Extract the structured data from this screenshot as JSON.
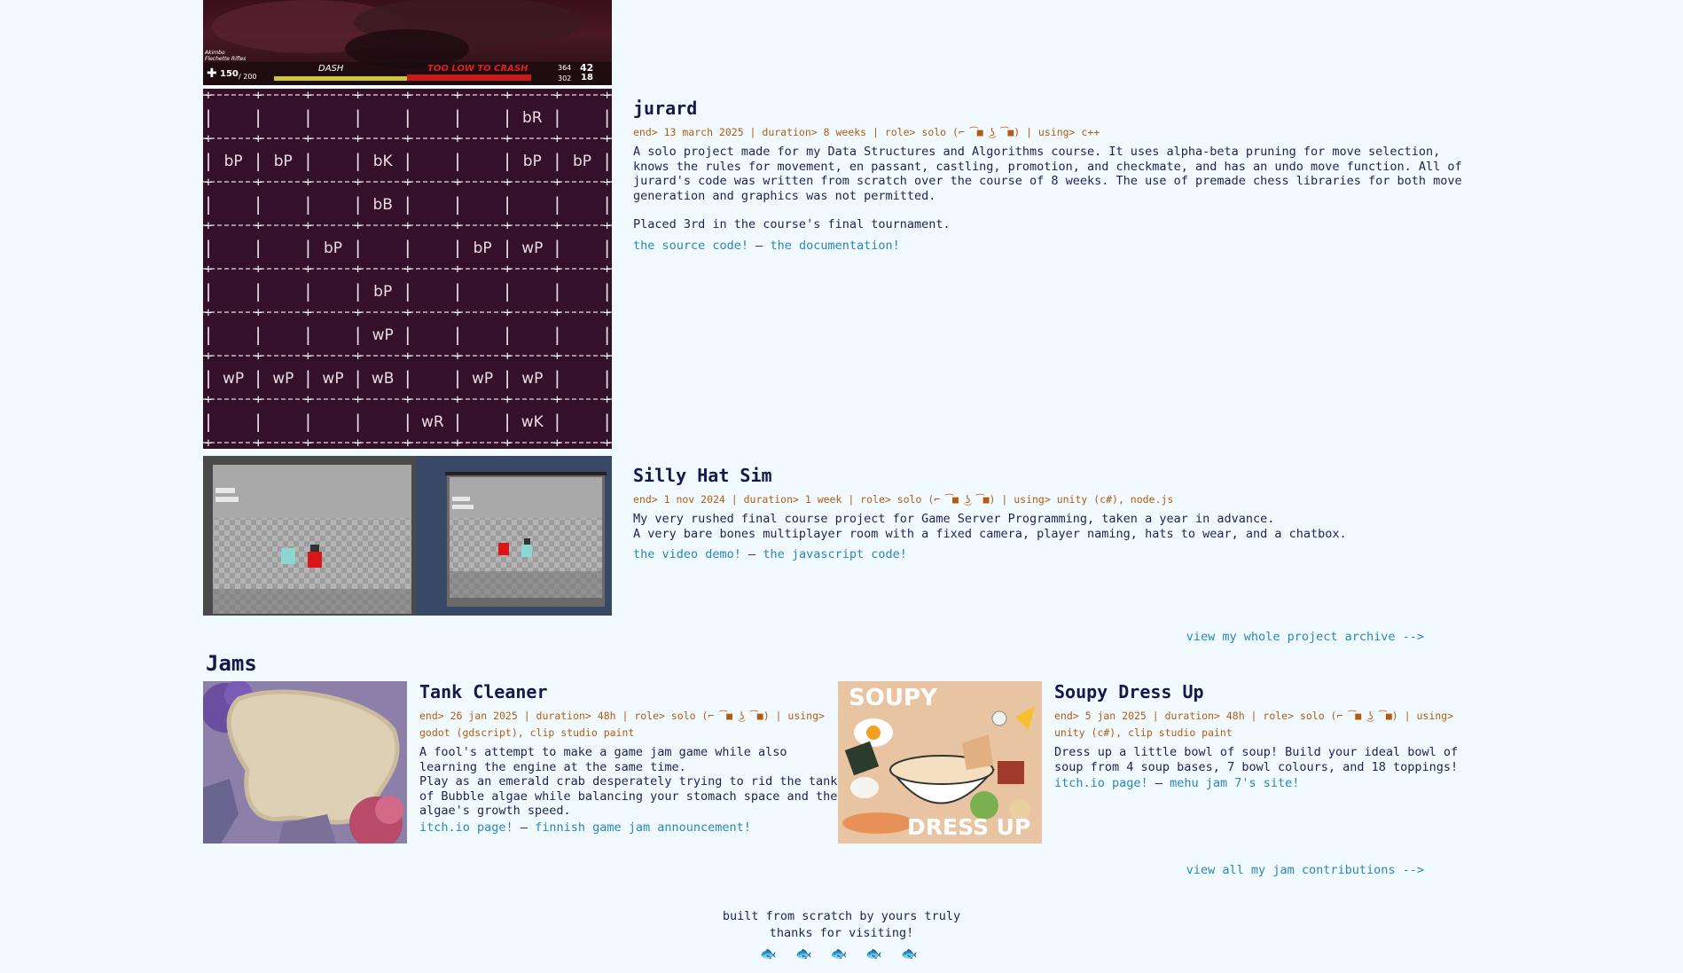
{
  "projects": [
    {
      "title": "jurard",
      "meta": "end> 13 march 2025 | duration> 8 weeks | role> solo (⌐ ͡■ ͜ʖ ͡■) | using> c++",
      "desc1": "A solo project made for my Data Structures and Algorithms course. It uses alpha-beta pruning for move selection, knows the rules for movement, en passant, castling, promotion, and checkmate, and has an undo move function. All of jurard's code was written from scratch over the course of 8 weeks. The use of premade chess libraries for both move generation and graphics was not permitted.",
      "desc2": "Placed 3rd in the course's final tournament.",
      "link1": "the source code!",
      "sep": " — ",
      "link2": "the documentation!"
    },
    {
      "title": "Silly Hat Sim",
      "meta": "end> 1 nov 2024 | duration> 1 week | role> solo (⌐ ͡■ ͜ʖ ͡■) | using> unity (c#), node.js",
      "desc1": "My very rushed final course project for Game Server Programming, taken a year in advance.",
      "desc2": "A very bare bones multiplayer room with a fixed camera, player naming, hats to wear, and a chatbox.",
      "link1": "the video demo!",
      "sep": " — ",
      "link2": "the javascript code!"
    }
  ],
  "hud": {
    "weapon": "Akimbo Flechette Rifles",
    "health": "150",
    "health_max": "/ 200",
    "dash": "DASH",
    "warning": "TOO LOW TO CRASH",
    "ammo_a": "364",
    "ammo_b": "42",
    "ammo_c": "302",
    "ammo_d": "18"
  },
  "chess": {
    "rows": [
      [
        "",
        "",
        "",
        "",
        "",
        "",
        "bR",
        ""
      ],
      [
        "bP",
        "bP",
        "",
        "bK",
        "",
        "",
        "bP",
        "bP"
      ],
      [
        "",
        "",
        "",
        "bB",
        "",
        "",
        "",
        ""
      ],
      [
        "",
        "",
        "bP",
        "",
        "",
        "bP",
        "wP",
        ""
      ],
      [
        "",
        "",
        "",
        "bP",
        "",
        "",
        "",
        ""
      ],
      [
        "",
        "",
        "",
        "wP",
        "",
        "",
        "",
        ""
      ],
      [
        "wP",
        "wP",
        "wP",
        "wB",
        "",
        "wP",
        "wP",
        ""
      ],
      [
        "",
        "",
        "",
        "",
        "wR",
        "",
        "wK",
        ""
      ]
    ]
  },
  "archive_link": "view my whole project archive -->",
  "jams_heading": "Jams",
  "jams": [
    {
      "title": "Tank Cleaner",
      "meta": "end> 26 jan 2025 | duration> 48h | role> solo (⌐ ͡■ ͜ʖ ͡■) | using> godot (gdscript), clip studio paint",
      "desc1": "A fool's attempt to make a game jam game while also learning the engine at the same time.",
      "desc2": "Play as an emerald crab desperately trying to rid the tank of Bubble algae while balancing your stomach space and the algae's growth speed.",
      "link1": "itch.io page!",
      "sep": " — ",
      "link2": "finnish game jam announcement!"
    },
    {
      "title": "Soupy Dress Up",
      "meta": "end> 5 jan 2025 | duration> 48h | role> solo (⌐ ͡■ ͜ʖ ͡■) | using> unity (c#), clip studio paint",
      "desc1": "Dress up a little bowl of soup! Build your ideal bowl of soup from 4 soup bases, 7 bowl colours, and 18 toppings!",
      "desc2": "",
      "link1": "itch.io page!",
      "sep": " — ",
      "link2": "mehu jam 7's site!",
      "art_top": "SOUPY",
      "art_bottom": "DRESS UP"
    }
  ],
  "jam_archive_link": "view all my jam contributions -->",
  "footer": {
    "line1": "built from scratch by yours truly",
    "line2": "thanks for visiting!",
    "fish": "🐟 🐟 🐟 🐟 🐟"
  },
  "colors": {
    "background": "#f1faff",
    "link": "#2a86b8",
    "meta": "#b35c10",
    "chess_board": "#35102a"
  }
}
